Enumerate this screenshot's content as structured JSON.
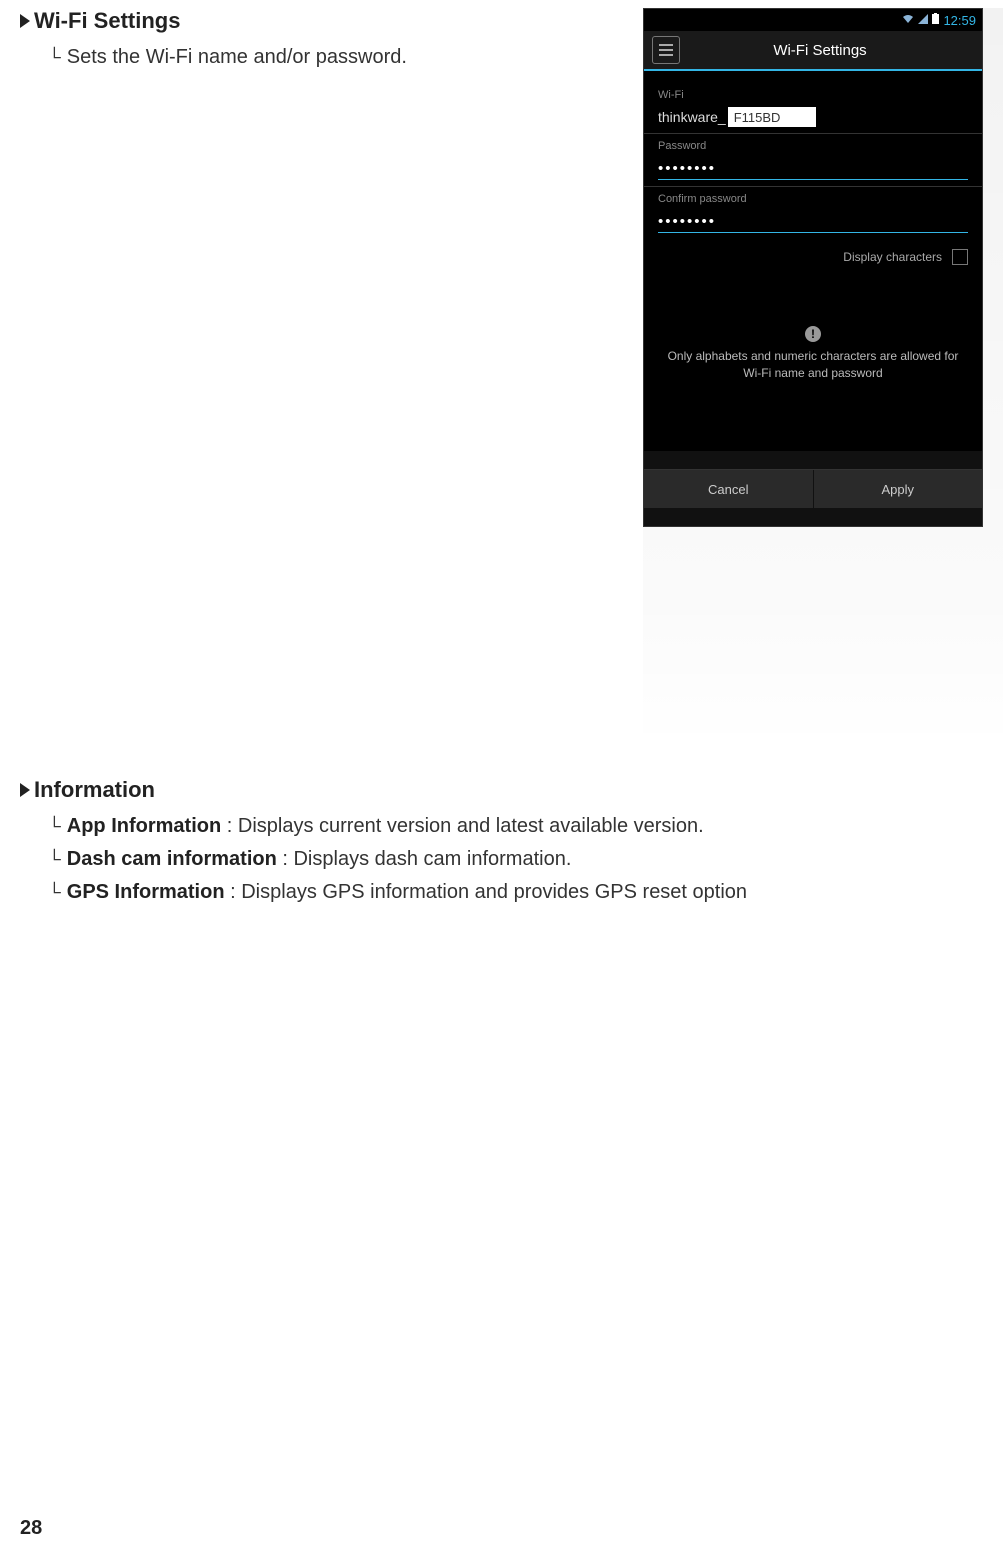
{
  "wifi_section": {
    "title": "Wi-Fi Settings",
    "description": "Sets the Wi-Fi name and/or password."
  },
  "info_section": {
    "title": "Information",
    "items": [
      {
        "label": "App Information",
        "desc": ": Displays current version and latest available version."
      },
      {
        "label": "Dash cam information",
        "desc": ": Displays dash cam information."
      },
      {
        "label": "GPS Information",
        "desc": ": Displays GPS information and provides GPS reset option"
      }
    ]
  },
  "page_number": "28",
  "phone": {
    "status_time": "12:59",
    "app_title": "Wi-Fi Settings",
    "wifi_label": "Wi-Fi",
    "wifi_prefix": "thinkware_",
    "wifi_value": "F115BD",
    "password_label": "Password",
    "password_value": "••••••••",
    "confirm_label": "Confirm password",
    "confirm_value": "••••••••",
    "display_chars": "Display characters",
    "warning_text": "Only alphabets and numeric characters are allowed for Wi-Fi name and password",
    "cancel": "Cancel",
    "apply": "Apply"
  }
}
